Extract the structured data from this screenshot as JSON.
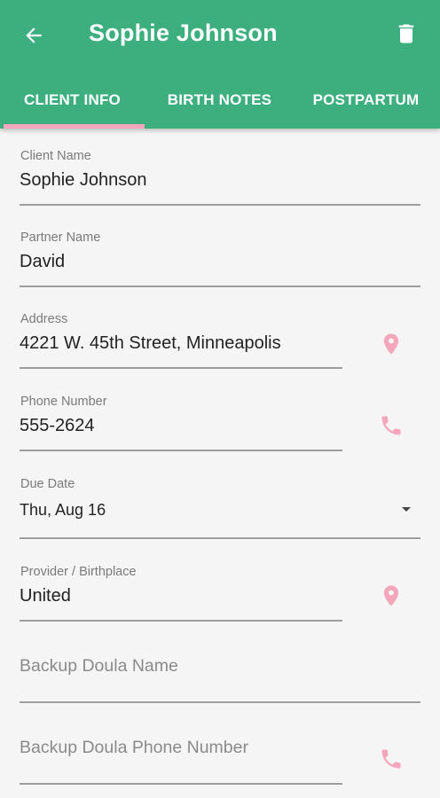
{
  "header": {
    "title": "Sophie Johnson",
    "back_icon": "arrow-back-icon",
    "delete_icon": "trash-icon"
  },
  "tabs": [
    {
      "label": "CLIENT INFO",
      "selected": true
    },
    {
      "label": "BIRTH NOTES",
      "selected": false
    },
    {
      "label": "POSTPARTUM",
      "selected": false
    }
  ],
  "form": {
    "client_name": {
      "label": "Client Name",
      "value": "Sophie Johnson"
    },
    "partner_name": {
      "label": "Partner Name",
      "value": "David"
    },
    "address": {
      "label": "Address",
      "value": "4221 W. 45th Street, Minneapolis",
      "icon": "location-pin-icon"
    },
    "phone": {
      "label": "Phone Number",
      "value": "555-2624",
      "icon": "phone-icon"
    },
    "due_date": {
      "label": "Due Date",
      "value": "Thu, Aug 16",
      "icon": "dropdown-arrow-icon"
    },
    "provider": {
      "label": "Provider / Birthplace",
      "value": "United",
      "icon": "location-pin-icon"
    },
    "backup_doula_name": {
      "placeholder": "Backup Doula Name"
    },
    "backup_doula_phone": {
      "placeholder": "Backup Doula Phone Number",
      "icon": "phone-icon"
    }
  },
  "colors": {
    "app_bar": "#3daf7f",
    "tab_indicator": "#f4a6bd",
    "accent_icon": "#f4a6bd",
    "background": "#f5f5f5"
  }
}
